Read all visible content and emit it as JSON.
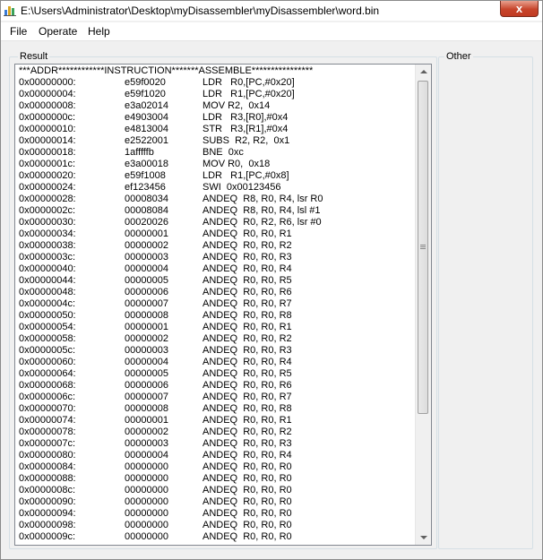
{
  "window": {
    "title": "E:\\Users\\Administrator\\Desktop\\myDisassembler\\myDisassembler\\word.bin",
    "close_glyph": "x"
  },
  "menu": [
    "File",
    "Operate",
    "Help"
  ],
  "result_group": {
    "label": "Result",
    "header": "***ADDR************INSTRUCTION*******ASSEMBLE****************",
    "rows": [
      {
        "addr": "0x00000000:",
        "code": "e59f0020",
        "asm": "LDR   R0,[PC,#0x20]"
      },
      {
        "addr": "0x00000004:",
        "code": "e59f1020",
        "asm": "LDR   R1,[PC,#0x20]"
      },
      {
        "addr": "0x00000008:",
        "code": "e3a02014",
        "asm": "MOV R2,  0x14"
      },
      {
        "addr": "0x0000000c:",
        "code": "e4903004",
        "asm": "LDR   R3,[R0],#0x4"
      },
      {
        "addr": "0x00000010:",
        "code": "e4813004",
        "asm": "STR   R3,[R1],#0x4"
      },
      {
        "addr": "0x00000014:",
        "code": "e2522001",
        "asm": "SUBS  R2, R2,  0x1"
      },
      {
        "addr": "0x00000018:",
        "code": "1afffffb",
        "asm": "BNE  0xc"
      },
      {
        "addr": "0x0000001c:",
        "code": "e3a00018",
        "asm": "MOV R0,  0x18"
      },
      {
        "addr": "0x00000020:",
        "code": "e59f1008",
        "asm": "LDR   R1,[PC,#0x8]"
      },
      {
        "addr": "0x00000024:",
        "code": "ef123456",
        "asm": "SWI  0x00123456"
      },
      {
        "addr": "0x00000028:",
        "code": "00008034",
        "asm": "ANDEQ  R8, R0, R4, lsr R0"
      },
      {
        "addr": "0x0000002c:",
        "code": "00008084",
        "asm": "ANDEQ  R8, R0, R4, lsl #1"
      },
      {
        "addr": "0x00000030:",
        "code": "00020026",
        "asm": "ANDEQ  R0, R2, R6, lsr #0"
      },
      {
        "addr": "0x00000034:",
        "code": "00000001",
        "asm": "ANDEQ  R0, R0, R1"
      },
      {
        "addr": "0x00000038:",
        "code": "00000002",
        "asm": "ANDEQ  R0, R0, R2"
      },
      {
        "addr": "0x0000003c:",
        "code": "00000003",
        "asm": "ANDEQ  R0, R0, R3"
      },
      {
        "addr": "0x00000040:",
        "code": "00000004",
        "asm": "ANDEQ  R0, R0, R4"
      },
      {
        "addr": "0x00000044:",
        "code": "00000005",
        "asm": "ANDEQ  R0, R0, R5"
      },
      {
        "addr": "0x00000048:",
        "code": "00000006",
        "asm": "ANDEQ  R0, R0, R6"
      },
      {
        "addr": "0x0000004c:",
        "code": "00000007",
        "asm": "ANDEQ  R0, R0, R7"
      },
      {
        "addr": "0x00000050:",
        "code": "00000008",
        "asm": "ANDEQ  R0, R0, R8"
      },
      {
        "addr": "0x00000054:",
        "code": "00000001",
        "asm": "ANDEQ  R0, R0, R1"
      },
      {
        "addr": "0x00000058:",
        "code": "00000002",
        "asm": "ANDEQ  R0, R0, R2"
      },
      {
        "addr": "0x0000005c:",
        "code": "00000003",
        "asm": "ANDEQ  R0, R0, R3"
      },
      {
        "addr": "0x00000060:",
        "code": "00000004",
        "asm": "ANDEQ  R0, R0, R4"
      },
      {
        "addr": "0x00000064:",
        "code": "00000005",
        "asm": "ANDEQ  R0, R0, R5"
      },
      {
        "addr": "0x00000068:",
        "code": "00000006",
        "asm": "ANDEQ  R0, R0, R6"
      },
      {
        "addr": "0x0000006c:",
        "code": "00000007",
        "asm": "ANDEQ  R0, R0, R7"
      },
      {
        "addr": "0x00000070:",
        "code": "00000008",
        "asm": "ANDEQ  R0, R0, R8"
      },
      {
        "addr": "0x00000074:",
        "code": "00000001",
        "asm": "ANDEQ  R0, R0, R1"
      },
      {
        "addr": "0x00000078:",
        "code": "00000002",
        "asm": "ANDEQ  R0, R0, R2"
      },
      {
        "addr": "0x0000007c:",
        "code": "00000003",
        "asm": "ANDEQ  R0, R0, R3"
      },
      {
        "addr": "0x00000080:",
        "code": "00000004",
        "asm": "ANDEQ  R0, R0, R4"
      },
      {
        "addr": "0x00000084:",
        "code": "00000000",
        "asm": "ANDEQ  R0, R0, R0"
      },
      {
        "addr": "0x00000088:",
        "code": "00000000",
        "asm": "ANDEQ  R0, R0, R0"
      },
      {
        "addr": "0x0000008c:",
        "code": "00000000",
        "asm": "ANDEQ  R0, R0, R0"
      },
      {
        "addr": "0x00000090:",
        "code": "00000000",
        "asm": "ANDEQ  R0, R0, R0"
      },
      {
        "addr": "0x00000094:",
        "code": "00000000",
        "asm": "ANDEQ  R0, R0, R0"
      },
      {
        "addr": "0x00000098:",
        "code": "00000000",
        "asm": "ANDEQ  R0, R0, R0"
      },
      {
        "addr": "0x0000009c:",
        "code": "00000000",
        "asm": "ANDEQ  R0, R0, R0"
      }
    ]
  },
  "other_group": {
    "label": "Other"
  },
  "scrollbar": {
    "position": 0
  }
}
